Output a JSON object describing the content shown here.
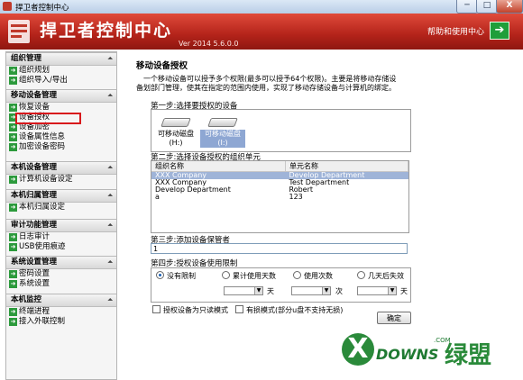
{
  "window": {
    "title": "捍卫者控制中心",
    "minimize": "─",
    "maximize": "□",
    "close": "X"
  },
  "header": {
    "app_name": "捍卫者控制中心",
    "version": "Ver 2014 5.6.0.0",
    "help_label": "帮助和使用中心",
    "help_icon": "arrow-right-icon"
  },
  "sidebar": {
    "groups": [
      {
        "title": "组织管理",
        "items": [
          "组织规划",
          "组织导入/导出"
        ]
      },
      {
        "title": "移动设备管理",
        "items": [
          "恢复设备",
          "设备授权",
          "设备加密",
          "设备属性信息",
          "加密设备密码"
        ]
      },
      {
        "title": "本机设备管理",
        "items": [
          "计算机设备设定"
        ]
      },
      {
        "title": "本机归属管理",
        "items": [
          "本机归属设定"
        ]
      },
      {
        "title": "审计功能管理",
        "items": [
          "日志审计",
          "USB使用痕迹"
        ]
      },
      {
        "title": "系统设置管理",
        "items": [
          "密码设置",
          "系统设置"
        ]
      },
      {
        "title": "本机监控",
        "items": [
          "终端进程",
          "接入外联控制"
        ]
      }
    ],
    "active_item": "设备授权"
  },
  "main": {
    "heading": "移动设备授权",
    "description": "一个移动设备可以授予多个权限(最多可以授予64个权限)。主要是将移动存储设备划部门管理，使其在指定的范围内使用，实现了移动存储设备与计算机的绑定。",
    "step1": {
      "label": "第一步:选择要授权的设备",
      "devices": [
        {
          "name": "可移动磁盘",
          "drive": "(H:)",
          "selected": false
        },
        {
          "name": "可移动磁盘",
          "drive": "(I:)",
          "selected": true
        }
      ]
    },
    "step2": {
      "label": "第二步:选择设备授权的组织单元",
      "columns": [
        "组织名称",
        "单元名称"
      ],
      "rows": [
        [
          "XXX Company",
          "Develop Department"
        ],
        [
          "XXX Company",
          "Test Department"
        ],
        [
          "Develop Department",
          "Robert"
        ],
        [
          "a",
          "123"
        ]
      ],
      "selected_row": 0
    },
    "step3": {
      "label": "第三步:添加设备保管者",
      "value": "1"
    },
    "step4": {
      "label": "第四步:授权设备使用限制",
      "options": [
        {
          "label": "没有限制",
          "checked": true
        },
        {
          "label": "累计使用天数",
          "checked": false
        },
        {
          "label": "使用次数",
          "checked": false
        },
        {
          "label": "几天后失效",
          "checked": false
        }
      ],
      "units": [
        "天",
        "次",
        "天"
      ]
    },
    "options": [
      "授权设备为只读模式",
      "有损模式(部分u盘不支持无损)"
    ],
    "confirm_label": "确定"
  },
  "watermark": {
    "x": "X",
    "downs": "DOWNS",
    "com": ".COM",
    "cn": "绿盟"
  }
}
